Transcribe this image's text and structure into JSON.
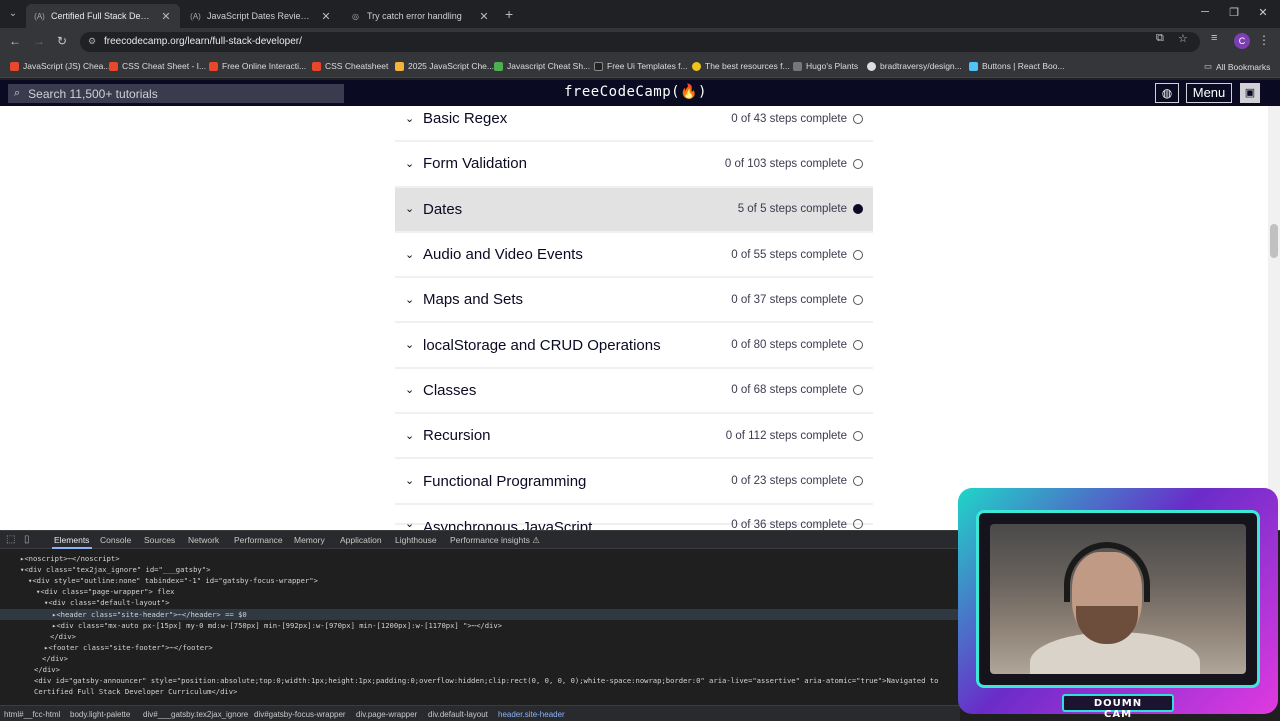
{
  "browser": {
    "tabs": [
      {
        "title": "Certified Full Stack Developer C",
        "favicon": "(A)"
      },
      {
        "title": "JavaScript Dates Review - JavaS",
        "favicon": "(A)"
      },
      {
        "title": "Try catch error handling",
        "favicon": "◎"
      }
    ],
    "url": "freecodecamp.org/learn/full-stack-developer/",
    "profile_initial": "C",
    "bookmarks": [
      {
        "label": "JavaScript (JS) Chea...",
        "color": "#e8472b"
      },
      {
        "label": "CSS Cheat Sheet - I...",
        "color": "#e8472b"
      },
      {
        "label": "Free Online Interacti...",
        "color": "#e8472b"
      },
      {
        "label": "CSS Cheatsheet",
        "color": "#e8472b"
      },
      {
        "label": "2025 JavaScript Che...",
        "color": "#f2b53a"
      },
      {
        "label": "Javascript Cheat Sh...",
        "color": "#4caf50"
      },
      {
        "label": "Free Ui Templates f...",
        "color": "#222222"
      },
      {
        "label": "The best resources f...",
        "color": "#f0c419"
      },
      {
        "label": "Hugo's Plants",
        "color": "#777777"
      },
      {
        "label": "bradtraversy/design...",
        "color": "#dddddd"
      },
      {
        "label": "Buttons | React Boo...",
        "color": "#4fc3f7"
      }
    ],
    "all_bookmarks": "All Bookmarks"
  },
  "fcc_header": {
    "search_placeholder": "Search 11,500+ tutorials",
    "logo": "freeCodeCamp(🔥)",
    "menu_label": "Menu"
  },
  "blocks": [
    {
      "title": "Basic Regex",
      "steps": "0 of 43 steps complete"
    },
    {
      "title": "Form Validation",
      "steps": "0 of 103 steps complete"
    },
    {
      "title": "Dates",
      "steps": "5 of 5 steps complete"
    },
    {
      "title": "Audio and Video Events",
      "steps": "0 of 55 steps complete"
    },
    {
      "title": "Maps and Sets",
      "steps": "0 of 37 steps complete"
    },
    {
      "title": "localStorage and CRUD Operations",
      "steps": "0 of 80 steps complete"
    },
    {
      "title": "Classes",
      "steps": "0 of 68 steps complete"
    },
    {
      "title": "Recursion",
      "steps": "0 of 112 steps complete"
    },
    {
      "title": "Functional Programming",
      "steps": "0 of 23 steps complete"
    },
    {
      "title": "Asynchronous JavaScript",
      "steps": "0 of 36 steps complete"
    }
  ],
  "devtools": {
    "tabs": [
      "Elements",
      "Console",
      "Sources",
      "Network",
      "Performance",
      "Memory",
      "Application",
      "Lighthouse",
      "Performance insights ⚠"
    ],
    "code_lines": [
      "▸<noscript>⋯</noscript>",
      "▾<div class=\"tex2jax_ignore\" id=\"___gatsby\">",
      "▾<div style=\"outline:none\" tabindex=\"-1\" id=\"gatsby-focus-wrapper\">",
      "▾<div class=\"page-wrapper\"> flex",
      "▾<div class=\"default-layout\">",
      "▸<header class=\"site-header\">⋯</header> == $0",
      "▸<div class=\"mx-auto px-[15px] my-0 md:w-[750px] min-[992px]:w-[970px] min-[1200px]:w-[1170px] \">⋯</div>",
      "</div>",
      "▸<footer class=\"site-footer\">⋯</footer>",
      "</div>",
      "</div>",
      "<div id=\"gatsby-announcer\" style=\"position:absolute;top:0;width:1px;height:1px;padding:0;overflow:hidden;clip:rect(0, 0, 0, 0);white-space:nowrap;border:0\" aria-live=\"assertive\" aria-atomic=\"true\">Navigated to",
      "Certified Full Stack Developer Curriculum</div>"
    ],
    "breadcrumbs": [
      "html#__fcc-html",
      "body.light-palette",
      "div#___gatsby.tex2jax_ignore",
      "div#gatsby-focus-wrapper",
      "div.page-wrapper",
      "div.default-layout",
      "header.site-header"
    ]
  },
  "webcam": {
    "label": "DOUMN CAM"
  }
}
